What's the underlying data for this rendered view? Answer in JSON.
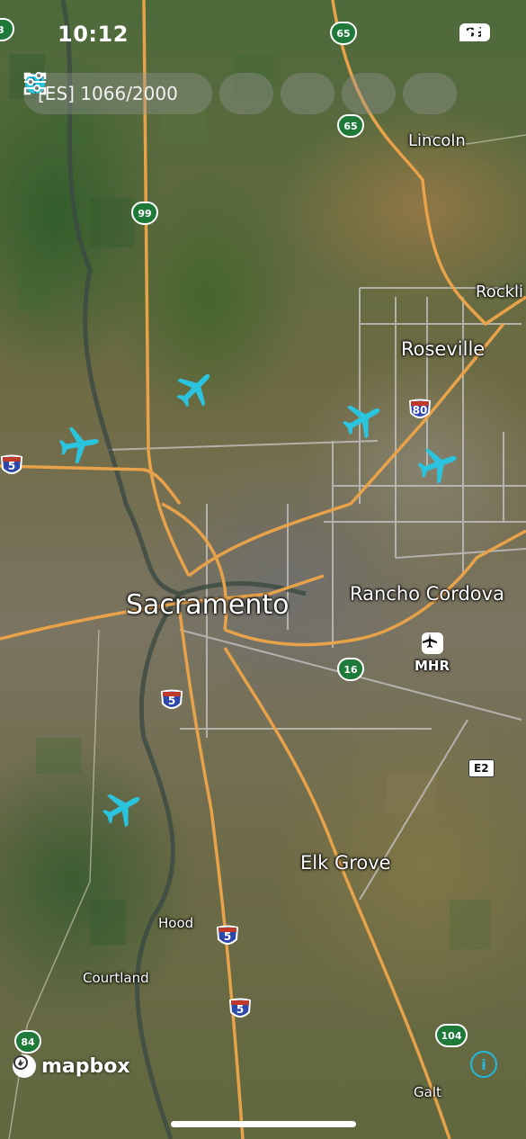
{
  "status_bar": {
    "time": "10:12",
    "battery": "89"
  },
  "toolbar": {
    "search_text": "[ES] 1066/2000",
    "search_icon": "search-icon",
    "locate_icon": "focus-icon",
    "globe_icon": "globe-icon",
    "settings_icon": "sliders-icon",
    "accent": "#2bc4df"
  },
  "map": {
    "cities": {
      "lincoln": "Lincoln",
      "rocklin": "Rockli",
      "roseville": "Roseville",
      "sacramento": "Sacramento",
      "rancho_cordova": "Rancho Cordova",
      "elk_grove": "Elk Grove",
      "hood": "Hood",
      "courtland": "Courtland",
      "galt": "Galt"
    },
    "airport": {
      "code": "MHR",
      "icon": "airport-icon"
    },
    "shields": {
      "i5_west": "5",
      "i5_center": "5",
      "i5_south_1": "5",
      "i5_south_2": "5",
      "i80": "80",
      "sr99": "99",
      "sr65_top": "65",
      "sr65": "65",
      "sr16": "16",
      "sr104": "104",
      "sr84": "84",
      "sr3_partial": "3",
      "e2": "E2"
    },
    "plane_color": "#2bc4df",
    "attribution": "mapbox",
    "info_icon": "info-icon"
  }
}
